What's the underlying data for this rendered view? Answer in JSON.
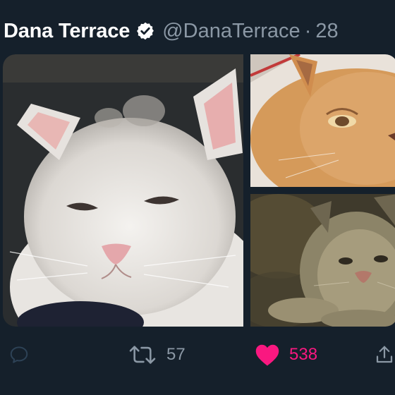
{
  "tweet": {
    "author_name": "Dana Terrace",
    "handle": "@DanaTerrace",
    "separator": "·",
    "time": "28",
    "verified": true
  },
  "media": {
    "images": [
      {
        "icon": "white-kitten-photo"
      },
      {
        "icon": "orange-cat-photo"
      },
      {
        "icon": "painted-cat-photo"
      }
    ]
  },
  "actions": {
    "reply_count": "",
    "retweet_count": "57",
    "like_count": "538",
    "liked": true
  },
  "colors": {
    "background": "#15202b",
    "secondary_text": "#8b98a5",
    "like": "#f91880"
  }
}
